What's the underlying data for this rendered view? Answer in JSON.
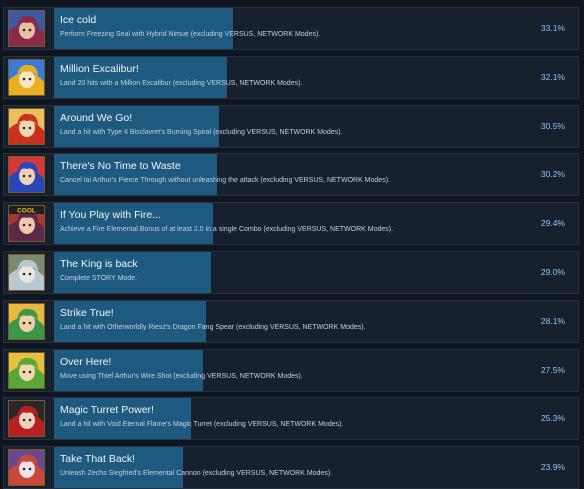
{
  "achievements": [
    {
      "title": "Ice cold",
      "desc": "Perform Freezing Seal with Hybrid Nimue (excluding VERSUS, NETWORK Modes).",
      "percent": "33.1%",
      "fill": 0.331,
      "icon": "character-portrait-nimue-icon",
      "colors": [
        "#8a2a4a",
        "#e8c0a0",
        "#3a5aa8"
      ]
    },
    {
      "title": "Million Excalibur!",
      "desc": "Land 20 hits with a Million Excalibur (excluding VERSUS, NETWORK Modes).",
      "percent": "32.1%",
      "fill": 0.321,
      "icon": "character-portrait-excalibur-icon",
      "colors": [
        "#e8b020",
        "#f8e8c0",
        "#3a7ad8"
      ]
    },
    {
      "title": "Around We Go!",
      "desc": "Land a hit with Type II Bisclavret's Burning Spiral (excluding VERSUS, NETWORK Modes).",
      "percent": "30.5%",
      "fill": 0.305,
      "icon": "character-portrait-bisclavret-icon",
      "colors": [
        "#c83020",
        "#f0d8b0",
        "#e8c060"
      ]
    },
    {
      "title": "There's No Time to Waste",
      "desc": "Cancel Iai Arthur's Pierce Through without unleashing the attack (excluding VERSUS, NETWORK Modes).",
      "percent": "30.2%",
      "fill": 0.302,
      "icon": "character-portrait-iai-arthur-icon",
      "colors": [
        "#2848b8",
        "#f0d0b8",
        "#d83838"
      ]
    },
    {
      "title": "If You Play with Fire...",
      "desc": "Achieve a Fire Elemental Bonus of at least 2.0 in a single Combo (excluding VERSUS, NETWORK Modes).",
      "percent": "29.4%",
      "fill": 0.294,
      "icon": "character-portrait-cool-icon",
      "badge": "COOL",
      "colors": [
        "#5a2a48",
        "#f0c8b0",
        "#a83838"
      ]
    },
    {
      "title": "The King is back",
      "desc": "Complete STORY Mode.",
      "percent": "29.0%",
      "fill": 0.29,
      "icon": "sword-in-stone-icon",
      "colors": [
        "#b8c8d0",
        "#e8e8e0",
        "#7a8a70"
      ]
    },
    {
      "title": "Strike True!",
      "desc": "Land a hit with Otherworldly Riesz's Dragon Fang Spear (excluding VERSUS, NETWORK Modes).",
      "percent": "28.1%",
      "fill": 0.281,
      "icon": "character-portrait-riesz-icon",
      "colors": [
        "#3a9848",
        "#f0d0a8",
        "#e8b840"
      ]
    },
    {
      "title": "Over Here!",
      "desc": "Move using Thief Arthur's Wire Shot (excluding VERSUS, NETWORK Modes).",
      "percent": "27.5%",
      "fill": 0.275,
      "icon": "character-portrait-thief-arthur-icon",
      "colors": [
        "#58a838",
        "#f0d8b0",
        "#e8c040"
      ]
    },
    {
      "title": "Magic Turret Power!",
      "desc": "Land a hit with Void Eternal Flame's Magic Turret (excluding VERSUS, NETWORK Modes).",
      "percent": "25.3%",
      "fill": 0.253,
      "icon": "character-portrait-eternal-flame-icon",
      "colors": [
        "#b82020",
        "#f0d0c0",
        "#282828"
      ]
    },
    {
      "title": "Take That Back!",
      "desc": "Unleash Zechs Siegfried's Elemental Cannon (excluding VERSUS, NETWORK Modes).",
      "percent": "23.9%",
      "fill": 0.239,
      "icon": "character-portrait-siegfried-icon",
      "colors": [
        "#c84838",
        "#f0e0e8",
        "#6a4890"
      ]
    }
  ]
}
